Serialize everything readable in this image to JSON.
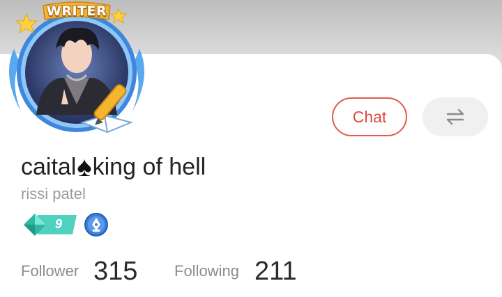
{
  "profile": {
    "badge_label": "WRITER",
    "display_name_part1": "caital",
    "display_name_symbol": "♠",
    "display_name_part2": "king of hell",
    "username": "rissi patel",
    "level": "9"
  },
  "actions": {
    "chat_label": "Chat",
    "switch_icon": "swap-arrows-icon"
  },
  "stats": {
    "follower_label": "Follower",
    "follower_count": "315",
    "following_label": "Following",
    "following_count": "211"
  },
  "colors": {
    "accent_red": "#e05a4e",
    "level_teal": "#3cc6b4",
    "frame_blue": "#4a8fe0",
    "gold": "#f2b233"
  }
}
